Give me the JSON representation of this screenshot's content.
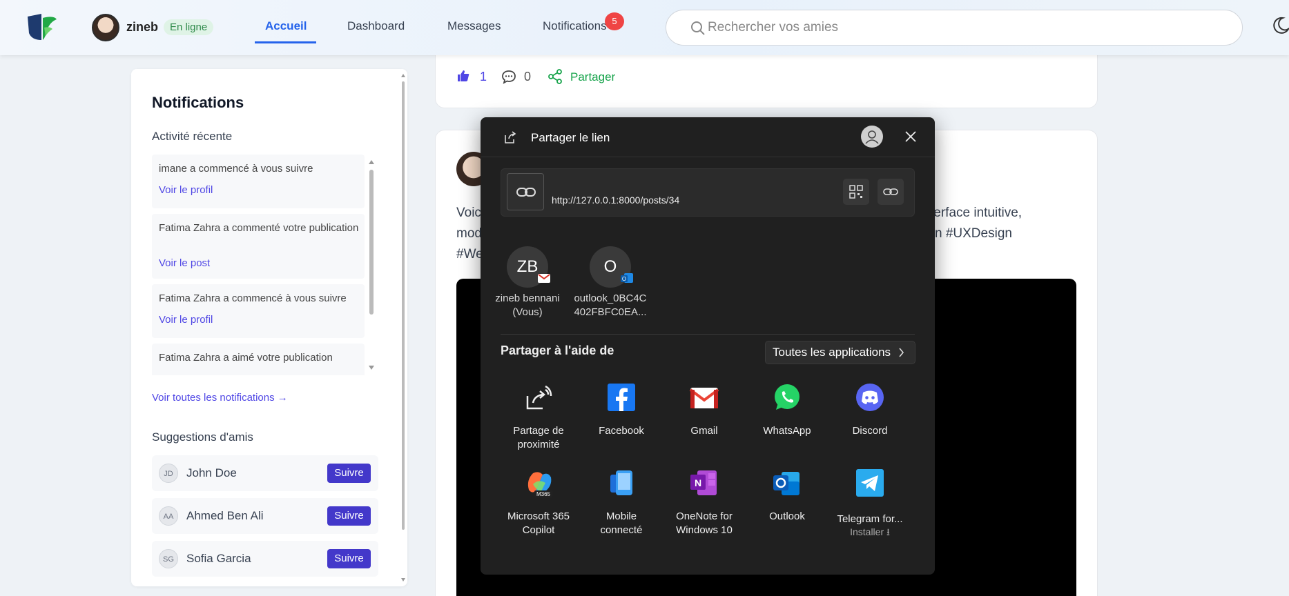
{
  "header": {
    "user_name": "zineb",
    "status": "En ligne",
    "nav": [
      "Accueil",
      "Dashboard",
      "Messages",
      "Notifications"
    ],
    "notification_count": "5",
    "search_placeholder": "Rechercher vos amies"
  },
  "sidebar": {
    "title": "Notifications",
    "recent_label": "Activité récente",
    "notifications": [
      {
        "text": "imane a commencé à vous suivre",
        "link": "Voir le profil"
      },
      {
        "text": "Fatima Zahra a commenté votre publication",
        "link": "Voir le post"
      },
      {
        "text": "Fatima Zahra a commencé à vous suivre",
        "link": "Voir le profil"
      },
      {
        "text": "Fatima Zahra a aimé votre publication",
        "link": ""
      }
    ],
    "see_all": "Voir toutes les notifications →",
    "suggestions_title": "Suggestions d'amis",
    "suggestions": [
      {
        "initials": "JD",
        "name": "John Doe",
        "action": "Suivre"
      },
      {
        "initials": "AA",
        "name": "Ahmed Ben Ali",
        "action": "Suivre"
      },
      {
        "initials": "SG",
        "name": "Sofia Garcia",
        "action": "Suivre"
      }
    ]
  },
  "feed": {
    "likes": "1",
    "comments": "0",
    "share": "Partager",
    "post_text_line1_start": "Voic",
    "post_text_line1_end": "terface intuitive,",
    "post_text_line2_start": "mod",
    "post_text_line2_end": "n #UXDesign",
    "post_text_line3_start": "#We"
  },
  "share_dialog": {
    "title": "Partager le lien",
    "url": "http://127.0.0.1:8000/posts/34",
    "contacts": [
      {
        "initials": "ZB",
        "name_line1": "zineb bennani",
        "name_line2": "(Vous)"
      },
      {
        "initials": "O",
        "name_line1": "outlook_0BC4C",
        "name_line2": "402FBFC0EA..."
      }
    ],
    "share_using": "Partager à l'aide de",
    "all_apps": "Toutes les applications",
    "apps": [
      {
        "label1": "Partage de",
        "label2": "proximité"
      },
      {
        "label1": "Facebook",
        "label2": ""
      },
      {
        "label1": "Gmail",
        "label2": ""
      },
      {
        "label1": "WhatsApp",
        "label2": ""
      },
      {
        "label1": "Discord",
        "label2": ""
      },
      {
        "label1": "Microsoft 365",
        "label2": "Copilot"
      },
      {
        "label1": "Mobile",
        "label2": "connecté"
      },
      {
        "label1": "OneNote for",
        "label2": "Windows 10"
      },
      {
        "label1": "Outlook",
        "label2": ""
      },
      {
        "label1": "Telegram for...",
        "label2": "Installer ⭳"
      }
    ]
  },
  "colors": {
    "accent": "#2563eb",
    "link": "#4f46e5",
    "follow_button": "#4338ca",
    "share_green": "#16a34a",
    "badge_red": "#ef4444",
    "dialog_bg": "#202020"
  }
}
